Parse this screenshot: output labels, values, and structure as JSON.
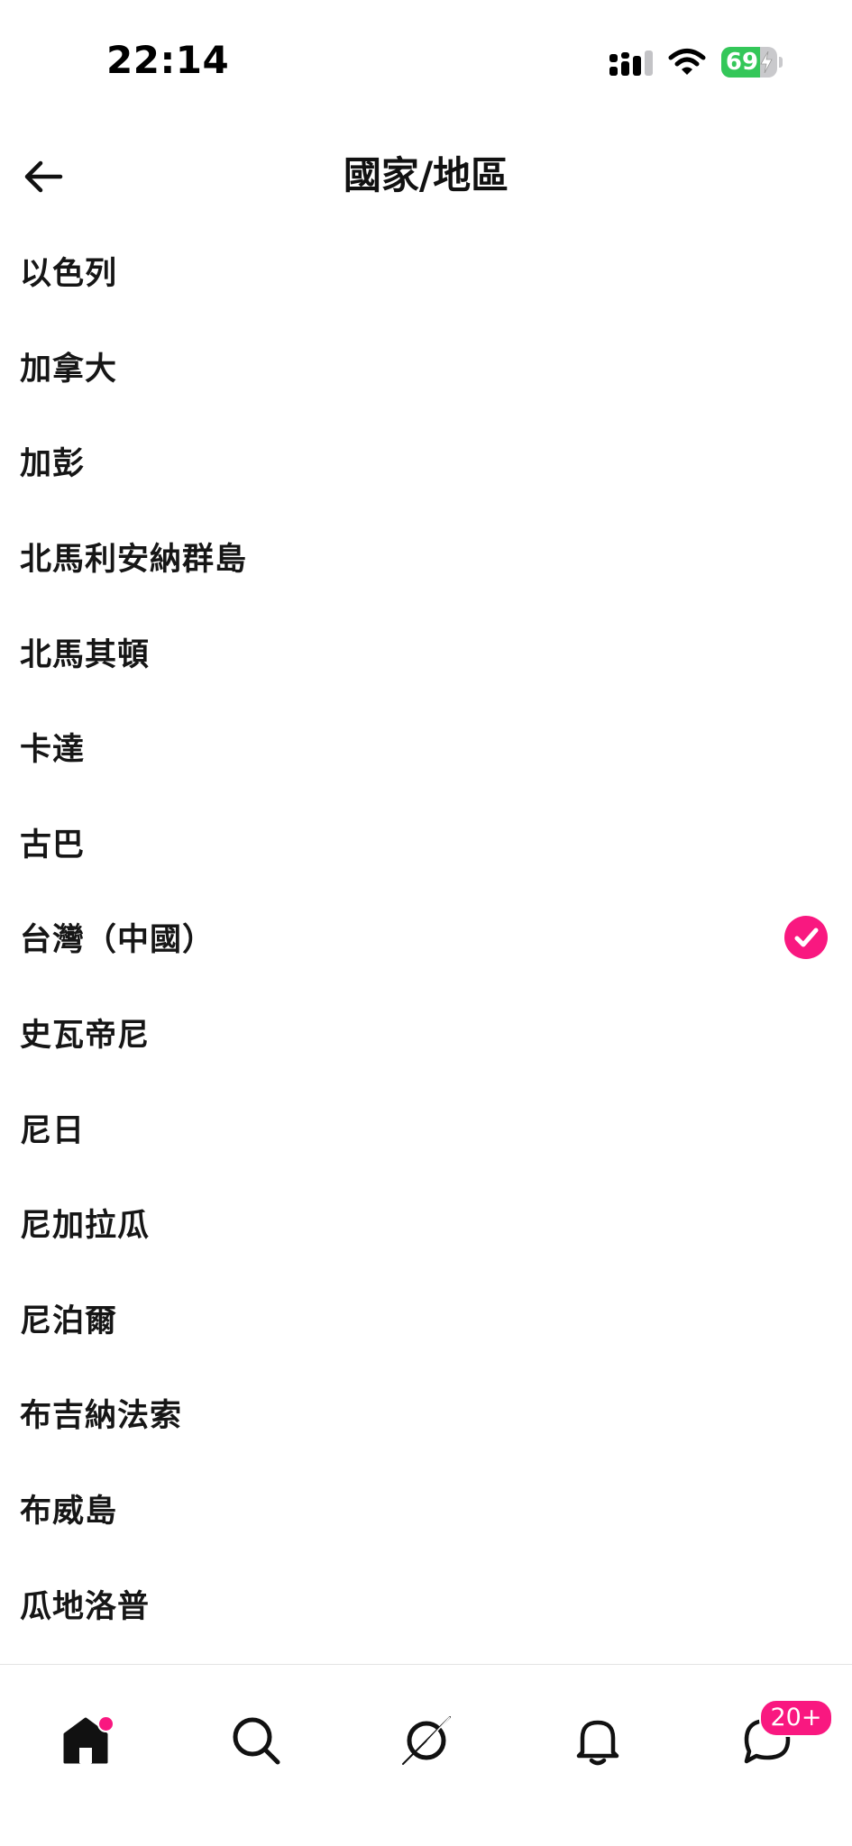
{
  "status_bar": {
    "time": "22:14",
    "battery_level": "69",
    "battery_percent": 69,
    "icons": [
      "signal-icon",
      "wifi-icon",
      "battery-charging-icon"
    ]
  },
  "header": {
    "title": "國家/地區",
    "back_icon": "arrow-left-icon"
  },
  "countries": [
    {
      "label": "以色列",
      "selected": false
    },
    {
      "label": "加拿大",
      "selected": false
    },
    {
      "label": "加彭",
      "selected": false
    },
    {
      "label": "北馬利安納群島",
      "selected": false
    },
    {
      "label": "北馬其頓",
      "selected": false
    },
    {
      "label": "卡達",
      "selected": false
    },
    {
      "label": "古巴",
      "selected": false
    },
    {
      "label": "台灣（中國）",
      "selected": true
    },
    {
      "label": "史瓦帝尼",
      "selected": false
    },
    {
      "label": "尼日",
      "selected": false
    },
    {
      "label": "尼加拉瓜",
      "selected": false
    },
    {
      "label": "尼泊爾",
      "selected": false
    },
    {
      "label": "布吉納法索",
      "selected": false
    },
    {
      "label": "布威島",
      "selected": false
    },
    {
      "label": "瓜地洛普",
      "selected": false
    }
  ],
  "bottom_nav": {
    "items": [
      {
        "icon": "home-icon",
        "active": true,
        "has_dot": true
      },
      {
        "icon": "search-icon",
        "active": false
      },
      {
        "icon": "explore-icon",
        "active": false
      },
      {
        "icon": "bell-icon",
        "active": false
      },
      {
        "icon": "messages-icon",
        "active": false
      }
    ],
    "messages_badge": "20+"
  },
  "colors": {
    "accent": "#f91880",
    "battery_fill": "#34c759",
    "text": "#161616",
    "divider": "#e3e3e3"
  }
}
